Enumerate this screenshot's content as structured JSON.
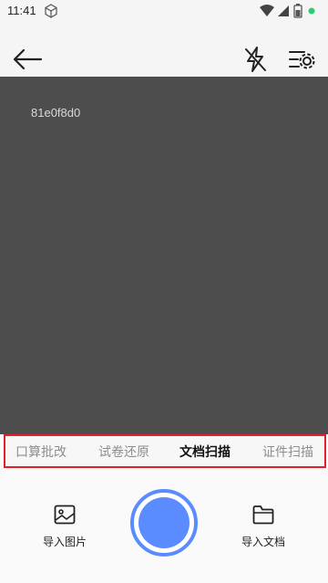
{
  "status_bar": {
    "time": "11:41"
  },
  "camera": {
    "overlay_text": "81e0f8d0"
  },
  "mode_tabs": [
    {
      "label": "口算批改",
      "active": false
    },
    {
      "label": "试卷还原",
      "active": false
    },
    {
      "label": "文档扫描",
      "active": true
    },
    {
      "label": "证件扫描",
      "active": false
    }
  ],
  "bottom_actions": {
    "import_image_label": "导入图片",
    "import_document_label": "导入文档"
  },
  "colors": {
    "accent": "#5b8cff",
    "camera_bg": "#4d4d4d",
    "highlight_border": "#e0202a",
    "battery_dot": "#2ecc71"
  }
}
